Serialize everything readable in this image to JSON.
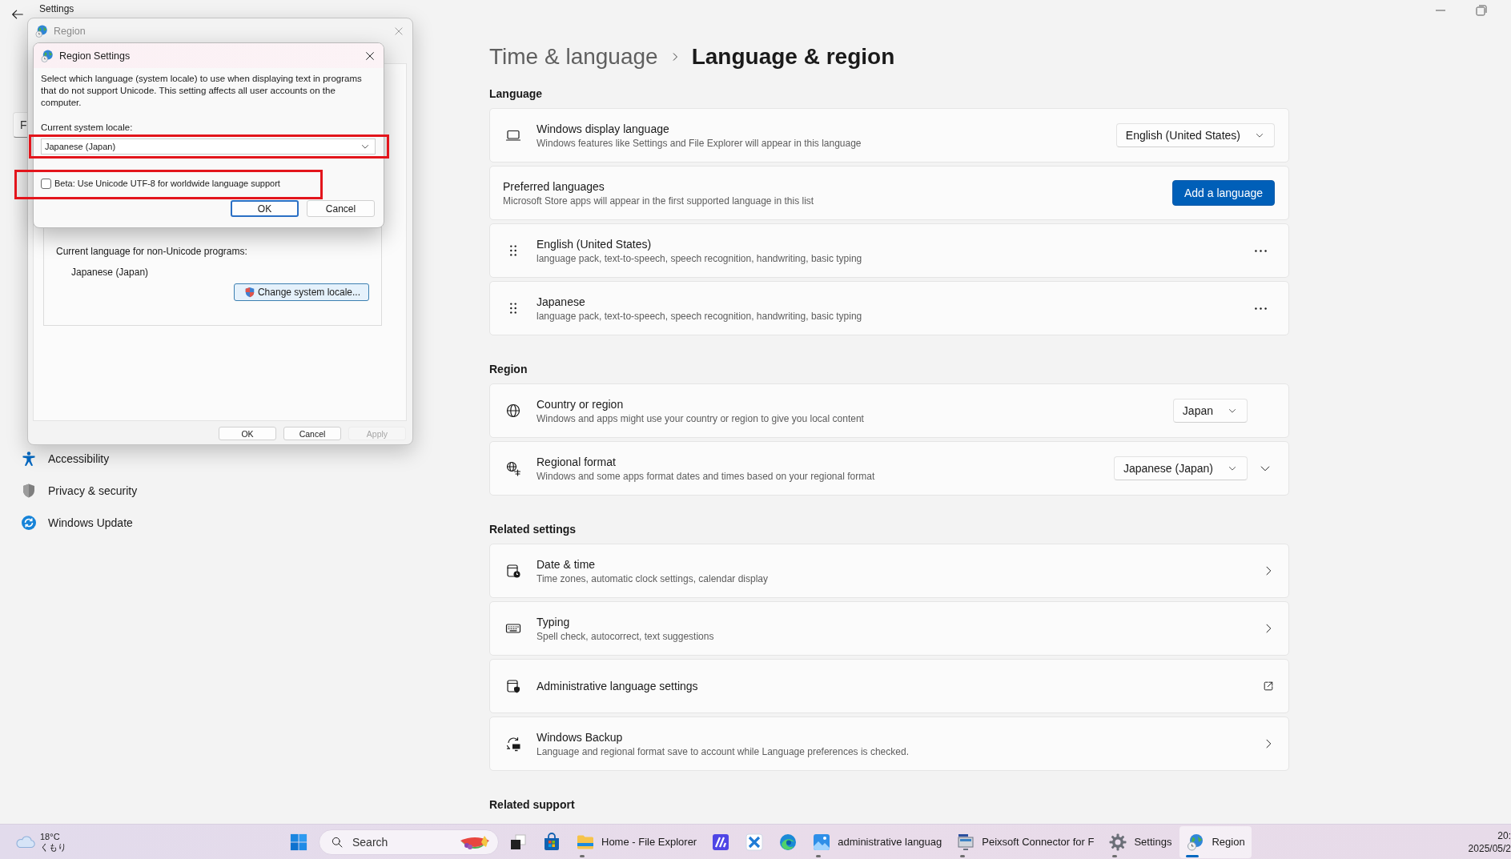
{
  "settings_window": {
    "title": "Settings"
  },
  "sidebar": {
    "search": {
      "placeholder": "F"
    },
    "items": [
      {
        "kind": "accessibility",
        "label": "Accessibility"
      },
      {
        "kind": "privacy",
        "label": "Privacy & security"
      },
      {
        "kind": "update",
        "label": "Windows Update"
      }
    ]
  },
  "breadcrumb": {
    "parent": "Time & language",
    "current": "Language & region"
  },
  "sections": [
    {
      "title": "Language",
      "cards": [
        {
          "kind": "dropdown",
          "title": "Windows display language",
          "subtitle": "Windows features like Settings and File Explorer will appear in this language",
          "value": "English (United States)"
        },
        {
          "kind": "button",
          "title": "Preferred languages",
          "subtitle": "Microsoft Store apps will appear in the first supported language in this list",
          "button": "Add a language"
        },
        {
          "kind": "language",
          "title": "English (United States)",
          "subtitle": "language pack, text-to-speech, speech recognition, handwriting, basic typing"
        },
        {
          "kind": "language",
          "title": "Japanese",
          "subtitle": "language pack, text-to-speech, speech recognition, handwriting, basic typing"
        }
      ]
    },
    {
      "title": "Region",
      "cards": [
        {
          "kind": "dropdown_expander",
          "title": "Country or region",
          "subtitle": "Windows and apps might use your country or region to give you local content",
          "value": "Japan"
        },
        {
          "kind": "dropdown_expander",
          "title": "Regional format",
          "subtitle": "Windows and some apps format dates and times based on your regional format",
          "value": "Japanese (Japan)",
          "expanded": false
        }
      ]
    },
    {
      "title": "Related settings",
      "cards": [
        {
          "kind": "link",
          "title": "Date & time",
          "subtitle": "Time zones, automatic clock settings, calendar display"
        },
        {
          "kind": "link",
          "title": "Typing",
          "subtitle": "Spell check, autocorrect, text suggestions"
        },
        {
          "kind": "external",
          "title": "Administrative language settings"
        },
        {
          "kind": "link",
          "title": "Windows Backup",
          "subtitle": "Language and regional format save to account while Language preferences is checked."
        }
      ]
    },
    {
      "title": "Related support"
    }
  ],
  "region_window": {
    "title": "Region",
    "current_language_label": "Current language for non-Unicode programs:",
    "current_language": "Japanese (Japan)",
    "change_button": "Change system locale...",
    "buttons": [
      {
        "label": "OK",
        "disabled": false
      },
      {
        "label": "Cancel",
        "disabled": false
      },
      {
        "label": "Apply",
        "disabled": true
      }
    ]
  },
  "region_settings_dialog": {
    "title": "Region Settings",
    "description": "Select which language (system locale) to use when displaying text in programs that do not support Unicode. This setting affects all user accounts on the computer.",
    "locale_label": "Current system locale:",
    "locale_value": "Japanese (Japan)",
    "beta_option": {
      "label": "Beta: Use Unicode UTF-8 for worldwide language support",
      "checked": false
    },
    "buttons": [
      {
        "label": "OK",
        "default": true
      },
      {
        "label": "Cancel",
        "default": false
      }
    ]
  },
  "taskbar": {
    "weather": {
      "temperature": "18°C",
      "condition": "くもり"
    },
    "search": {
      "placeholder": "Search"
    },
    "apps": [
      {
        "running": false,
        "selected": false
      },
      {
        "running": false,
        "selected": false
      },
      {
        "label": "Home - File Explorer",
        "running": true,
        "selected": false
      },
      {
        "running": false,
        "selected": false
      },
      {
        "running": false,
        "selected": false
      },
      {
        "running": false,
        "selected": false
      },
      {
        "label": "administrative languag",
        "running": true,
        "selected": false
      },
      {
        "label": "Peixsoft Connector for F",
        "running": true,
        "selected": false
      },
      {
        "label": "Settings",
        "running": true,
        "selected": false
      },
      {
        "label": "Region",
        "running": true,
        "selected": true
      }
    ],
    "clock": {
      "time": "20:",
      "date": "2025/05/2"
    }
  }
}
